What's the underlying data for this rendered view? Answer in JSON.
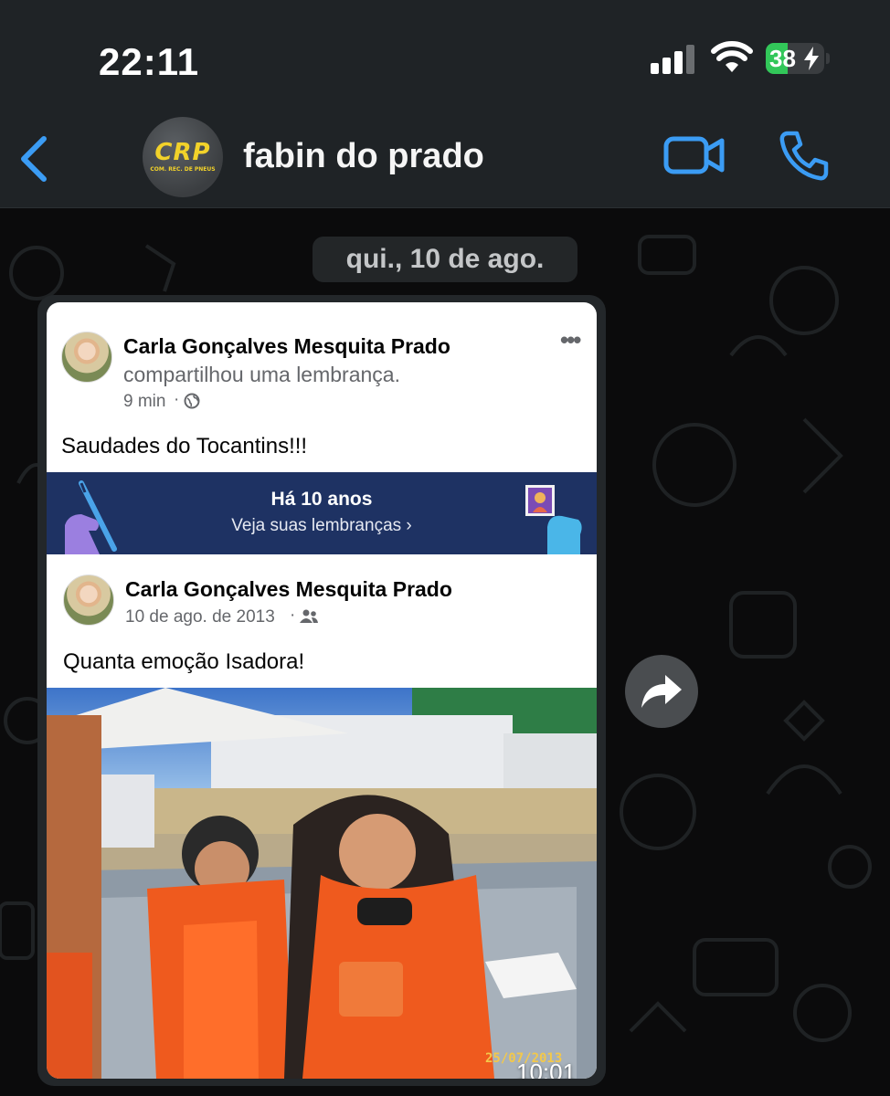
{
  "status_bar": {
    "time": "22:11",
    "battery_percent": "38",
    "battery_level": 0.38,
    "icons": [
      "cellular-signal-icon",
      "wifi-icon",
      "battery-charging-icon"
    ]
  },
  "header": {
    "contact_name": "fabin do prado",
    "avatar_logo_text": "CRP",
    "avatar_logo_subtext": "COM. REC. DE PNEUS",
    "icons": [
      "back-chevron-icon",
      "video-call-icon",
      "phone-call-icon"
    ],
    "accent_color": "#3b9cf4"
  },
  "chat": {
    "date_separator": "qui., 10 de ago.",
    "message": {
      "timestamp": "10:01",
      "shared_post": {
        "author": "Carla Gonçalves Mesquita Prado",
        "action": "compartilhou uma lembrança.",
        "time_ago": "9 min",
        "caption": "Saudades do Tocantins!!!",
        "memories_banner": {
          "title": "Há 10 anos",
          "link": "Veja suas lembranças"
        },
        "original_post": {
          "author": "Carla Gonçalves Mesquita Prado",
          "date": "10 de ago. de 2013",
          "caption": "Quanta emoção  Isadora!",
          "photo_date_stamp": "25/07/2013"
        }
      }
    }
  }
}
